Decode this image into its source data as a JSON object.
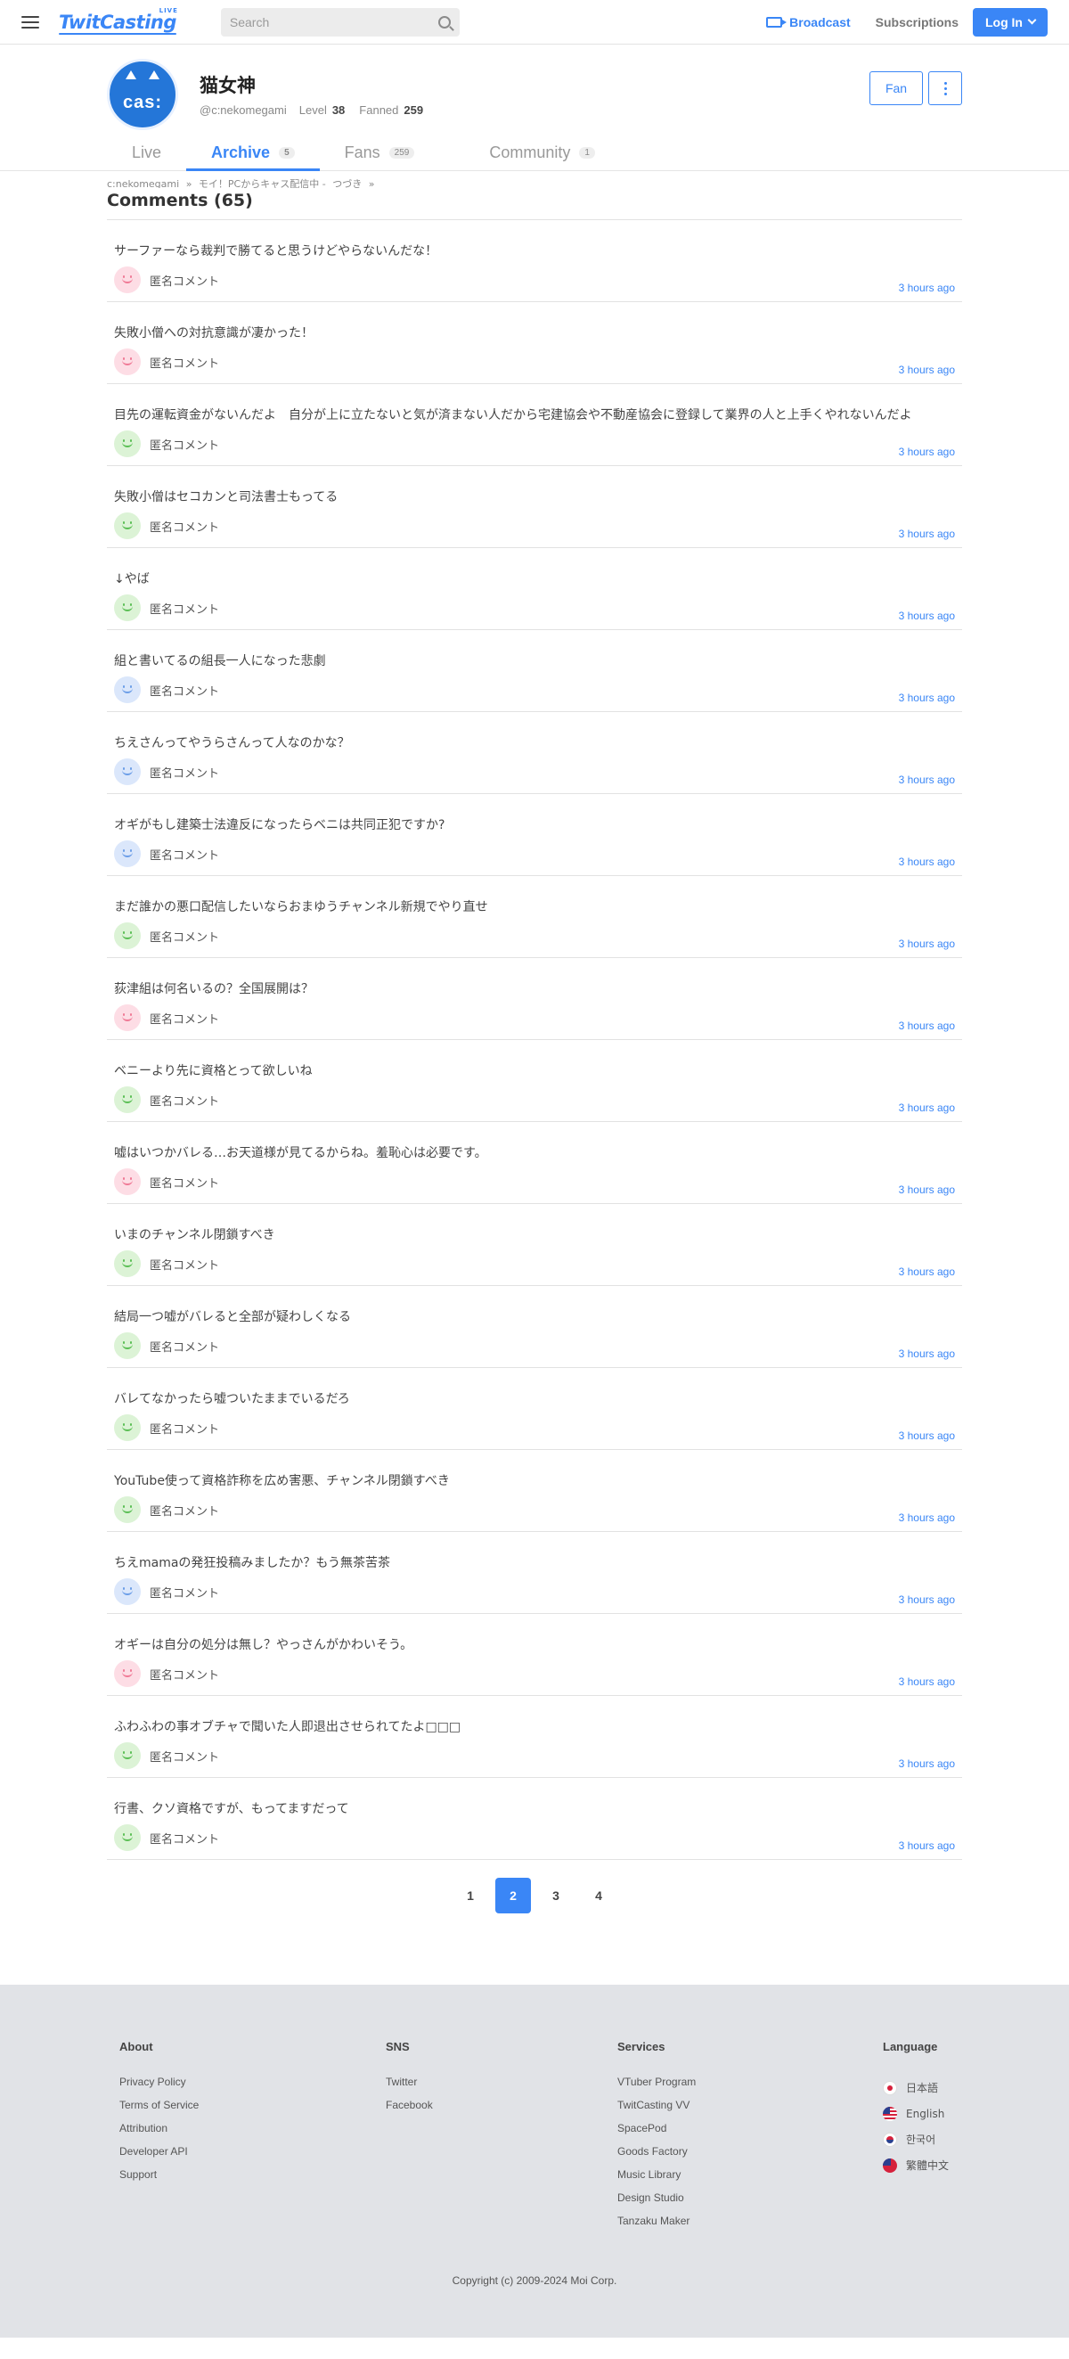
{
  "header": {
    "logo": "TwitCasting",
    "logo_sub": "LIVE",
    "search_placeholder": "Search",
    "broadcast": "Broadcast",
    "subscriptions": "Subscriptions",
    "login": "Log In",
    "accent": "#3a86f6"
  },
  "profile": {
    "avatar_text": "cas:",
    "name": "猫女神",
    "handle": "@c:nekomegami",
    "level_label": "Level",
    "level": "38",
    "fanned_label": "Fanned",
    "fanned": "259",
    "fan_button": "Fan"
  },
  "tabs": [
    {
      "label": "Live",
      "count": ""
    },
    {
      "label": "Archive",
      "count": "5"
    },
    {
      "label": "Fans",
      "count": "259"
    },
    {
      "label": "Community",
      "count": "1"
    }
  ],
  "breadcrumb": [
    "c:nekomegami",
    "»",
    "モイ！PCからキャス配信中 -",
    "つづき",
    "»"
  ],
  "page_title": "Comments (65)",
  "comments": [
    {
      "text": "サーファーなら裁判で勝てると思うけどやらないんだな！",
      "user": "匿名コメント",
      "time": "3 hours ago",
      "face": "pink"
    },
    {
      "text": "失敗小僧への対抗意識が凄かった！",
      "user": "匿名コメント",
      "time": "3 hours ago",
      "face": "pink"
    },
    {
      "text": "目先の運転資金がないんだよ　自分が上に立たないと気が済まない人だから宅建協会や不動産協会に登録して業界の人と上手くやれないんだよ",
      "user": "匿名コメント",
      "time": "3 hours ago",
      "face": "green"
    },
    {
      "text": "失敗小僧はセコカンと司法書士もってる",
      "user": "匿名コメント",
      "time": "3 hours ago",
      "face": "green"
    },
    {
      "text": "↓やば",
      "user": "匿名コメント",
      "time": "3 hours ago",
      "face": "green"
    },
    {
      "text": "組と書いてるの組長一人になった悲劇",
      "user": "匿名コメント",
      "time": "3 hours ago",
      "face": "blue"
    },
    {
      "text": "ちえさんってやうらさんって人なのかな？",
      "user": "匿名コメント",
      "time": "3 hours ago",
      "face": "blue"
    },
    {
      "text": "オギがもし建築士法違反になったらベニは共同正犯ですか?",
      "user": "匿名コメント",
      "time": "3 hours ago",
      "face": "blue"
    },
    {
      "text": "まだ誰かの悪口配信したいならおまゆうチャンネル新規でやり直せ",
      "user": "匿名コメント",
      "time": "3 hours ago",
      "face": "green"
    },
    {
      "text": "荻津組は何名いるの？全国展開は？",
      "user": "匿名コメント",
      "time": "3 hours ago",
      "face": "pink"
    },
    {
      "text": "ベニーより先に資格とって欲しいね",
      "user": "匿名コメント",
      "time": "3 hours ago",
      "face": "green"
    },
    {
      "text": "嘘はいつかバレる…お天道様が見てるからね。羞恥心は必要です。",
      "user": "匿名コメント",
      "time": "3 hours ago",
      "face": "pink"
    },
    {
      "text": "いまのチャンネル閉鎖すべき",
      "user": "匿名コメント",
      "time": "3 hours ago",
      "face": "green"
    },
    {
      "text": "結局一つ嘘がバレると全部が疑わしくなる",
      "user": "匿名コメント",
      "time": "3 hours ago",
      "face": "green"
    },
    {
      "text": "バレてなかったら嘘ついたままでいるだろ",
      "user": "匿名コメント",
      "time": "3 hours ago",
      "face": "green"
    },
    {
      "text": "YouTube使って資格詐称を広め害悪、チャンネル閉鎖すべき",
      "user": "匿名コメント",
      "time": "3 hours ago",
      "face": "green"
    },
    {
      "text": "ちえmamaの発狂投稿みましたか？もう無茶苦茶",
      "user": "匿名コメント",
      "time": "3 hours ago",
      "face": "blue"
    },
    {
      "text": "オギーは自分の処分は無し？やっさんがかわいそう。",
      "user": "匿名コメント",
      "time": "3 hours ago",
      "face": "pink"
    },
    {
      "text": "ふわふわの事オブチャで聞いた人即退出させられてたよ□□□",
      "user": "匿名コメント",
      "time": "3 hours ago",
      "face": "green"
    },
    {
      "text": "行書、クソ資格ですが、もってますだって",
      "user": "匿名コメント",
      "time": "3 hours ago",
      "face": "green"
    }
  ],
  "pagination": {
    "pages": [
      "1",
      "2",
      "3",
      "4"
    ],
    "current": "2"
  },
  "footer": {
    "about": {
      "title": "About",
      "links": [
        "Privacy Policy",
        "Terms of Service",
        "Attribution",
        "Developer API",
        "Support"
      ]
    },
    "sns": {
      "title": "SNS",
      "links": [
        "Twitter",
        "Facebook"
      ]
    },
    "services": {
      "title": "Services",
      "links": [
        "VTuber Program",
        "TwitCasting VV",
        "SpacePod",
        "Goods Factory",
        "Music Library",
        "Design Studio",
        "Tanzaku Maker"
      ]
    },
    "language": {
      "title": "Language",
      "items": [
        {
          "label": "日本語",
          "flag": "jp"
        },
        {
          "label": "English",
          "flag": "us"
        },
        {
          "label": "한국어",
          "flag": "kr"
        },
        {
          "label": "繁體中文",
          "flag": "tw"
        }
      ]
    },
    "copyright": "Copyright (c) 2009-2024 Moi Corp."
  }
}
